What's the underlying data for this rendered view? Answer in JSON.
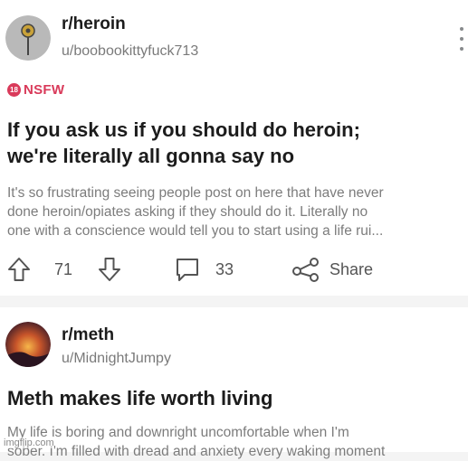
{
  "posts": [
    {
      "subreddit": "r/heroin",
      "username": "u/boobookittyfuck713",
      "nsfw_badge": "18",
      "nsfw_label": "NSFW",
      "title_lines": [
        "If you ask us if you should do heroin;",
        "we're literally all gonna say no"
      ],
      "body_lines": [
        "It's so frustrating seeing people post on here that have never",
        "done heroin/opiates asking if they should do it.  Literally no",
        "one with a conscience would tell you to start using a life rui..."
      ],
      "upvotes": "71",
      "comments": "33",
      "share_label": "Share",
      "icons": [
        "upvote-icon",
        "downvote-icon",
        "comment-icon",
        "share-icon",
        "more-options-icon"
      ]
    },
    {
      "subreddit": "r/meth",
      "username": "u/MidnightJumpy",
      "title": "Meth makes life worth living",
      "body_lines": [
        "My life is boring and downright uncomfortable when I'm",
        "sober. I'm filled with dread and anxiety every waking moment"
      ]
    }
  ],
  "watermark": "imgflip.com",
  "colors": {
    "nsfw": "#d93a5a",
    "secondary_text": "#7c7c7c",
    "page_background": "#f4f4f4"
  }
}
